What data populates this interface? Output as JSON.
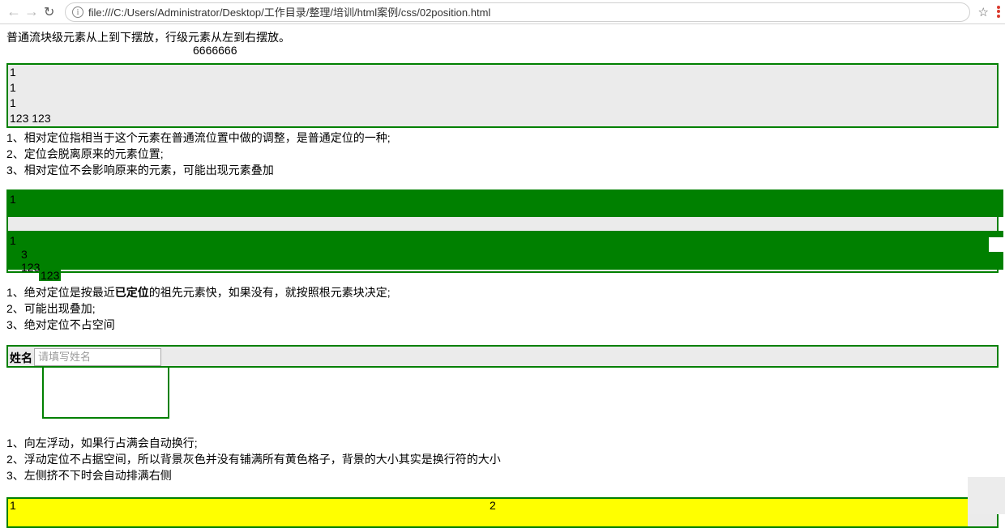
{
  "browser": {
    "url": "file:///C:/Users/Administrator/Desktop/工作目录/整理/培训/html案例/css/02position.html"
  },
  "intro": {
    "p1": "普通流块级元素从上到下摆放，行级元素从左到右摆放。",
    "six": "6666666"
  },
  "box1": {
    "l1": "1",
    "l2": "1",
    "l3": "1",
    "l4": "123 123"
  },
  "rel_notes": {
    "l1": "1、相对定位指相当于这个元素在普通流位置中做的调整，是普通定位的一种;",
    "l2": "2、定位会脱离原来的元素位置;",
    "l3": "3、相对定位不会影响原来的元素，可能出现元素叠加"
  },
  "box2": {
    "l1": "1",
    "l2": "1",
    "l3": "3",
    "l4": "123",
    "tag": "123"
  },
  "abs_notes": {
    "l1_pre": "1、绝对定位是按最近",
    "l1_b": "已定位",
    "l1_post": "的祖先元素快，如果没有，就按照根元素块决定;",
    "l2": "2、可能出现叠加;",
    "l3": "3、绝对定位不占空间"
  },
  "form": {
    "label": "姓名",
    "placeholder": "请填写姓名"
  },
  "float_notes": {
    "l1": "1、向左浮动，如果行占满会自动换行;",
    "l2": "2、浮动定位不占据空间，所以背景灰色并没有铺满所有黄色格子，背景的大小其实是换行符的大小",
    "l3": "3、左侧挤不下时会自动排满右侧"
  },
  "float_cells": {
    "c1": "1",
    "c2": "2"
  }
}
